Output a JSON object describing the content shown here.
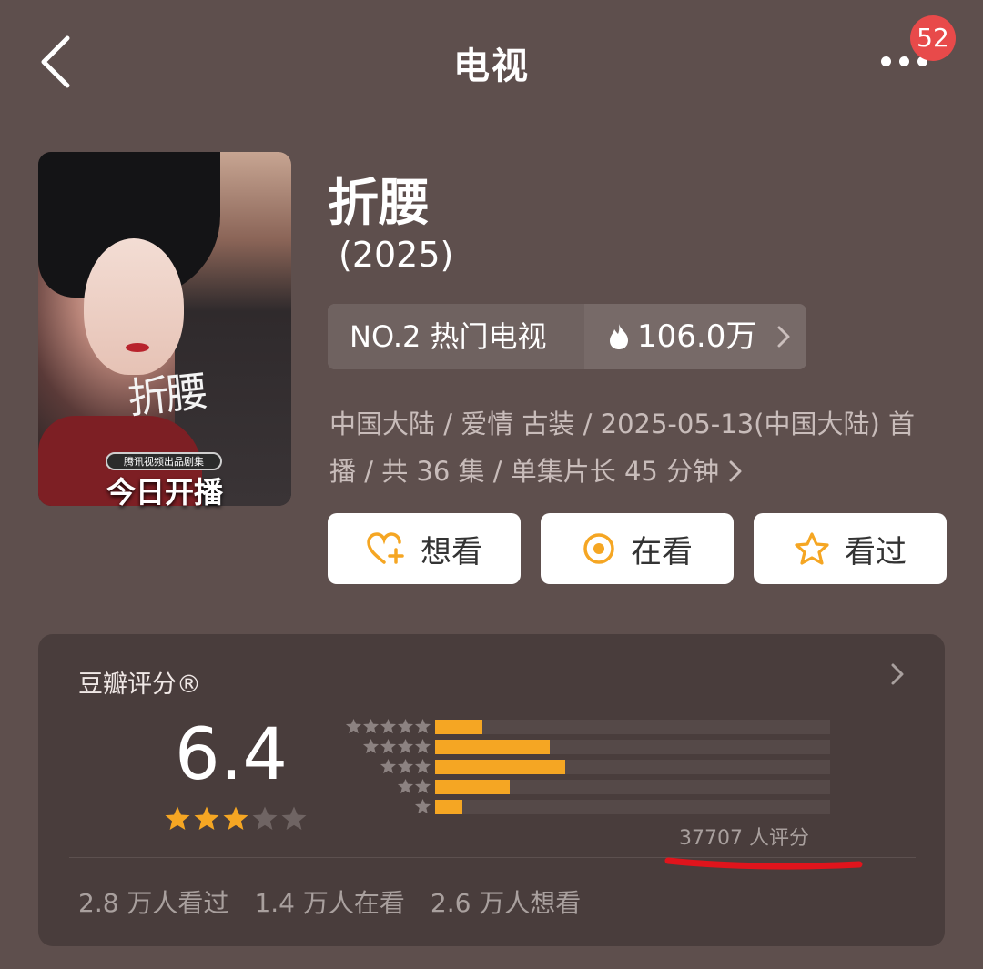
{
  "header": {
    "title": "电视",
    "notification_count": "52"
  },
  "poster": {
    "title_calligraphy": "折腰",
    "tag": "腾讯视频出品剧集",
    "caption": "今日开播"
  },
  "show": {
    "title": "折腰",
    "year": "(2025)",
    "rank_label": "NO.2 热门电视",
    "heat_value": "106.0万",
    "meta_line1": "中国大陆 / 爱情 古装 / 2025-05-13(中国大陆) 首",
    "meta_line2": "播 / 共 36 集 / 单集片长 45 分钟"
  },
  "actions": {
    "want_label": "想看",
    "watching_label": "在看",
    "watched_label": "看过"
  },
  "rating": {
    "title": "豆瓣评分®",
    "score": "6.4",
    "score_stars": 3,
    "distribution": [
      {
        "stars": 5,
        "fraction": 0.12
      },
      {
        "stars": 4,
        "fraction": 0.29
      },
      {
        "stars": 3,
        "fraction": 0.33
      },
      {
        "stars": 2,
        "fraction": 0.19
      },
      {
        "stars": 1,
        "fraction": 0.07
      }
    ],
    "count_text": "37707 人评分",
    "watched_text": "2.8 万人看过",
    "watching_text": "1.4 万人在看",
    "want_text": "2.6 万人想看"
  },
  "colors": {
    "background": "#5e4f4d",
    "card": "#493d3c",
    "star": "#f5a623",
    "badge": "#e84a4a",
    "annotation": "#e0141c"
  }
}
